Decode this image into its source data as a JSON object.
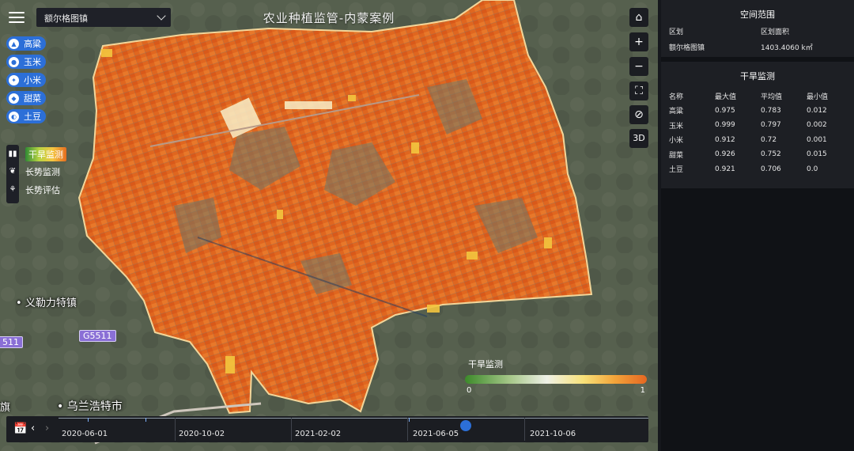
{
  "title": "农业种植监管-内蒙案例",
  "region_select": {
    "value": "额尔格图镇"
  },
  "crops": [
    {
      "label": "高粱",
      "icon": "sorghum-icon"
    },
    {
      "label": "玉米",
      "icon": "corn-icon"
    },
    {
      "label": "小米",
      "icon": "millet-icon"
    },
    {
      "label": "甜菜",
      "icon": "beet-icon"
    },
    {
      "label": "土豆",
      "icon": "potato-icon"
    }
  ],
  "monitors": [
    {
      "label": "干旱监测",
      "icon": "bars-icon",
      "active": true
    },
    {
      "label": "长势监测",
      "icon": "sprout-icon",
      "active": false
    },
    {
      "label": "长势评估",
      "icon": "plant-pot-icon",
      "active": false
    }
  ],
  "map_controls": [
    {
      "name": "home-button",
      "icon": "home-icon",
      "glyph": "⌂"
    },
    {
      "name": "zoom-in-button",
      "icon": "plus-icon",
      "glyph": "+"
    },
    {
      "name": "zoom-out-button",
      "icon": "minus-icon",
      "glyph": "−"
    },
    {
      "name": "fullscreen-button",
      "icon": "expand-icon",
      "glyph": "⛶"
    },
    {
      "name": "visibility-button",
      "icon": "eye-off-icon",
      "glyph": "⊘"
    },
    {
      "name": "3d-button",
      "icon": "3d-icon",
      "glyph": "3D"
    }
  ],
  "map_labels": {
    "town1": "义勒力特镇",
    "city": "乌兰浩特市",
    "partial": "旗",
    "road_left": "511",
    "road": "G5511"
  },
  "legend": {
    "title": "干旱监测",
    "min": "0",
    "max": "1",
    "colors": [
      "#3c8a2a",
      "#eef0e6",
      "#f8e27a",
      "#e56721"
    ]
  },
  "timeline": {
    "dates": [
      "2020-06-01",
      "2020-10-02",
      "2021-02-02",
      "2021-06-05",
      "2021-10-06"
    ],
    "current_fraction": 0.69
  },
  "spatial": {
    "title": "空间范围",
    "col1": "区划",
    "col2": "区划面积",
    "district": "额尔格图镇",
    "area": "1403.4060 k㎡"
  },
  "drought": {
    "title": "干旱监测",
    "headers": [
      "名称",
      "最大值",
      "平均值",
      "最小值"
    ],
    "rows": [
      [
        "高粱",
        "0.975",
        "0.783",
        "0.012"
      ],
      [
        "玉米",
        "0.999",
        "0.797",
        "0.002"
      ],
      [
        "小米",
        "0.912",
        "0.72",
        "0.001"
      ],
      [
        "甜菜",
        "0.926",
        "0.752",
        "0.015"
      ],
      [
        "土豆",
        "0.921",
        "0.706",
        "0.0"
      ]
    ]
  }
}
